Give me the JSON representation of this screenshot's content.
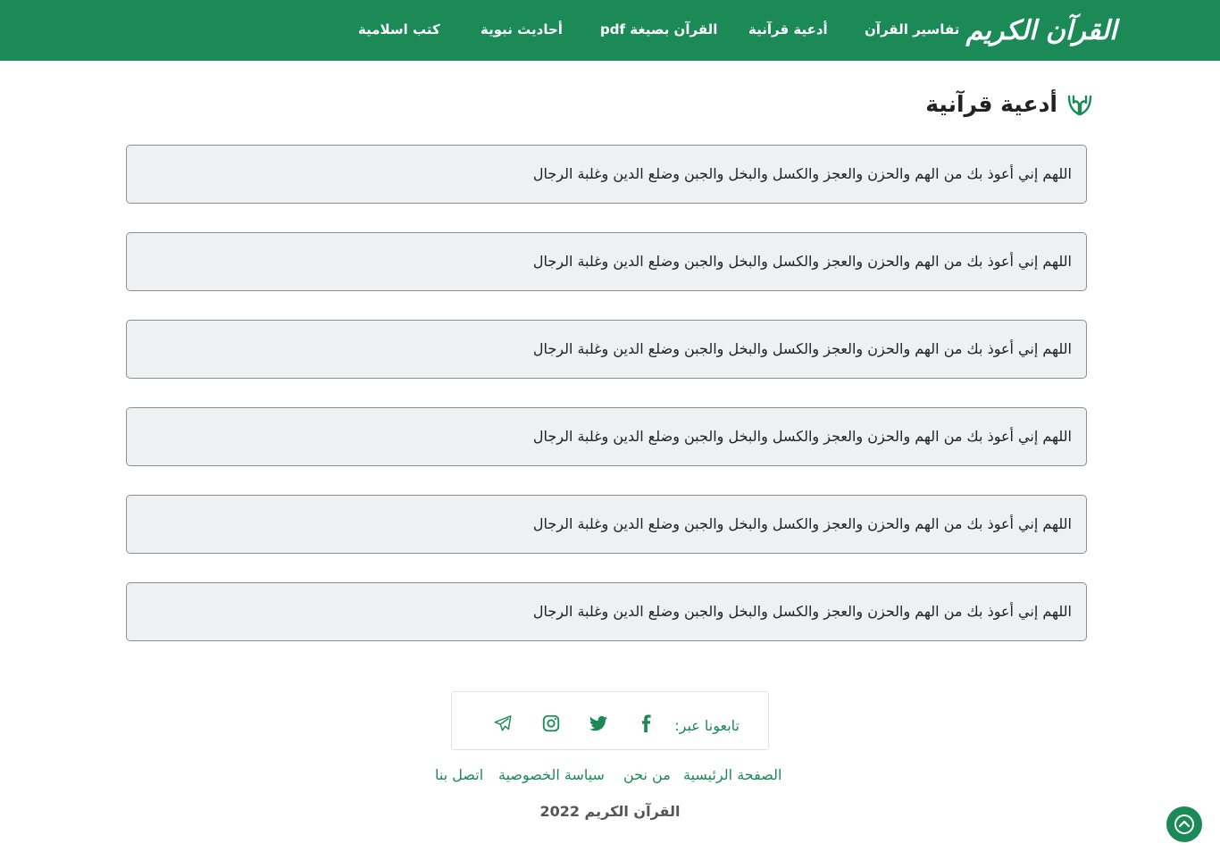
{
  "header": {
    "logo_text": "القرآن الكريم",
    "nav": [
      "تفاسير القرآن",
      "أدعية قرآنية",
      "القرآن بصيغة pdf",
      "أحاديث نبوية",
      "كتب اسلامية"
    ]
  },
  "main": {
    "title": "أدعية قرآنية",
    "title_icon": "praying-hands-icon",
    "duas": [
      "اللهم إني أعوذ بك من الهم والحزن والعجز والكسل والبخل والجبن وضلع الدين وغلبة الرجال",
      "اللهم إني أعوذ بك من الهم والحزن والعجز والكسل والبخل والجبن وضلع الدين وغلبة الرجال",
      "اللهم إني أعوذ بك من الهم والحزن والعجز والكسل والبخل والجبن وضلع الدين وغلبة الرجال",
      "اللهم إني أعوذ بك من الهم والحزن والعجز والكسل والبخل والجبن وضلع الدين وغلبة الرجال",
      "اللهم إني أعوذ بك من الهم والحزن والعجز والكسل والبخل والجبن وضلع الدين وغلبة الرجال",
      "اللهم إني أعوذ بك من الهم والحزن والعجز والكسل والبخل والجبن وضلع الدين وغلبة الرجال"
    ]
  },
  "footer": {
    "follow_label": "تابعونا عبر:",
    "social_icons": [
      "facebook-icon",
      "twitter-icon",
      "instagram-icon",
      "telegram-icon"
    ],
    "links": [
      "الصفحة الرئيسية",
      "من نحن",
      "سياسة الخصوصية",
      "اتصل بنا"
    ],
    "copyright": "القرآن الكريم 2022"
  },
  "colors": {
    "brand_green": "#1b8a57",
    "card_bg": "#eff0f2",
    "card_border": "#8e8e8e"
  }
}
